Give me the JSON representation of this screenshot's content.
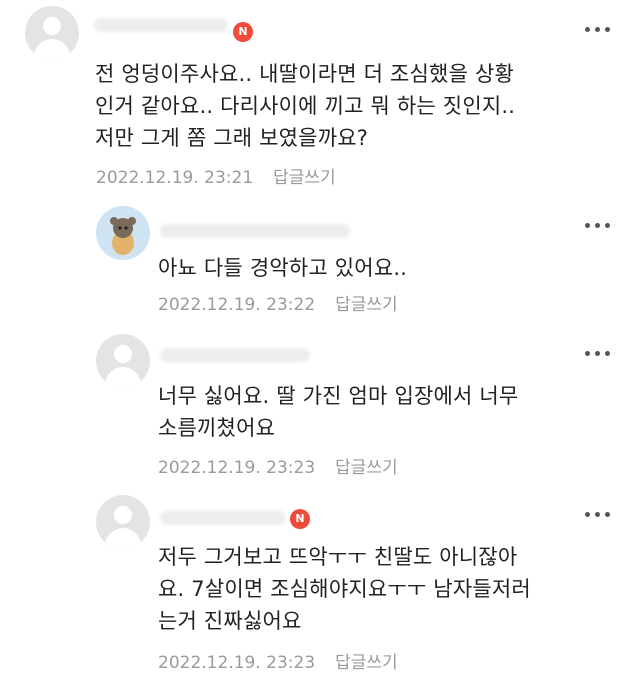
{
  "comments": [
    {
      "badge": "N",
      "lines": [
        "전 엉덩이주사요.. 내딸이라면 더 조심했을 상황",
        "인거 같아요.. 다리사이에 끼고 뭐 하는 짓인지..",
        "저만 그게 쫌 그래 보였을까요?"
      ],
      "date": "2022.12.19. 23:21",
      "reply": "답글쓰기"
    },
    {
      "badge": "",
      "lines": [
        "아뇨 다들 경악하고 있어요.."
      ],
      "date": "2022.12.19. 23:22",
      "reply": "답글쓰기"
    },
    {
      "badge": "",
      "lines": [
        "너무 싫어요. 딸 가진 엄마 입장에서 너무",
        "소름끼쳤어요"
      ],
      "date": "2022.12.19. 23:23",
      "reply": "답글쓰기"
    },
    {
      "badge": "N",
      "lines": [
        "저두 그거보고 뜨악ㅜㅜ 친딸도 아니잖아",
        "요. 7살이면 조심해야지요ㅜㅜ 남자들저러",
        "는거 진짜싫어요"
      ],
      "date": "2022.12.19. 23:23",
      "reply": "답글쓰기"
    }
  ],
  "colors": {
    "badge": "#ee4b3b",
    "meta": "#9a9a9a",
    "text": "#222222"
  },
  "icons": {
    "more": "more-vertical-dots-icon",
    "avatar": "default-profile-icon"
  }
}
